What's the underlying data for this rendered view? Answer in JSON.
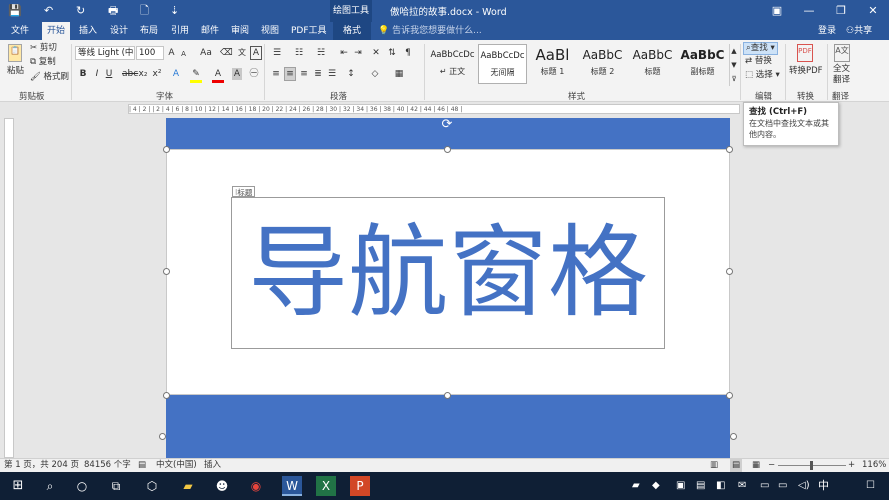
{
  "titlebar": {
    "qa_save": "💾",
    "qa_undo": "↶",
    "qa_redo": "↻",
    "qa_print": "🖶",
    "qa_new": "🗋",
    "qa_more": "⇣",
    "context_tools": "绘图工具",
    "doc_title": "傲哈拉的故事.docx - Word",
    "win_ribbon": "▣",
    "win_min": "—",
    "win_max": "❐",
    "win_close": "✕"
  },
  "tabs": [
    "文件",
    "开始",
    "插入",
    "设计",
    "布局",
    "引用",
    "邮件",
    "审阅",
    "视图",
    "PDF工具",
    "格式"
  ],
  "tell_me": "告诉我您想要做什么...",
  "account": {
    "login": "登录",
    "share": "共享"
  },
  "ribbon": {
    "clipboard": {
      "paste": "粘贴",
      "cut": "剪切",
      "copy": "复制",
      "format_painter": "格式刷",
      "label": "剪贴板"
    },
    "font": {
      "name": "等线 Light (中",
      "size": "100",
      "label": "字体"
    },
    "paragraph": {
      "label": "段落"
    },
    "styles": {
      "label": "样式",
      "items": [
        {
          "sample": "AaBbCcDc",
          "name": "↵ 正文"
        },
        {
          "sample": "AaBbCcDc",
          "name": "无间隔"
        },
        {
          "sample": "AaBl",
          "name": "标题 1"
        },
        {
          "sample": "AaBbC",
          "name": "标题 2"
        },
        {
          "sample": "AaBbC",
          "name": "标题"
        },
        {
          "sample": "AaBbC",
          "name": "副标题"
        }
      ]
    },
    "editing": {
      "find": "查找",
      "replace": "替换",
      "select": "选择",
      "label": "编辑"
    },
    "convert": {
      "to_pdf": "转换PDF",
      "label": "转换"
    },
    "translate": {
      "full": "全文",
      "translate": "翻译",
      "label": "翻译"
    }
  },
  "tooltip": {
    "title": "查找 (Ctrl+F)",
    "desc": "在文档中查找文本或其他内容。"
  },
  "ruler": "| 4 | 2 |   | 2 | 4 | 6 | 8 | 10 | 12 | 14 | 16 | 18 | 20 | 22 | 24 | 26 | 28 | 30 | 32 | 34 | 36 | 38 | 40 | 42 | 44 | 46 | 48 |",
  "document": {
    "textbox_tag": "标题",
    "heading": "导航窗格"
  },
  "status": {
    "page": "第 1 页，共 204 页",
    "words": "84156 个字",
    "lang": "中文(中国)",
    "mode": "插入",
    "zoom": "116%"
  },
  "taskbar": {
    "ime": "中",
    "time": "",
    "notify": "☐"
  },
  "colors": {
    "word_blue": "#2b579a",
    "accent": "#4472c4"
  }
}
